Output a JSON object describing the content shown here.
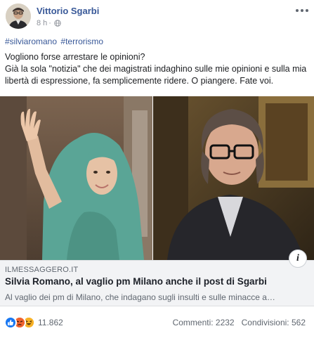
{
  "post": {
    "author": "Vittorio Sgarbi",
    "time": "8 h",
    "hashtags": [
      "#silviaromano",
      "#terrorismo"
    ],
    "text_line1": "Vogliono forse arrestare le opinioni?",
    "text_line2": "Già la sola \"notizia\" che dei magistrati indaghino sulle mie opinioni e sulla mia libertà di espressione, fa semplicemente ridere. O piangere. Fate voi."
  },
  "link": {
    "domain": "ILMESSAGGERO.IT",
    "title": "Silvia Romano, al vaglio pm Milano anche il post di Sgarbi",
    "description": "Al vaglio dei pm di Milano, che indagano sugli insulti e sulle minacce a…",
    "info_glyph": "i"
  },
  "footer": {
    "reaction_count": "11.862",
    "comments": "Commenti: 2232",
    "shares": "Condivisioni: 562"
  },
  "icons": {
    "reactions": [
      "like-icon",
      "angry-icon",
      "haha-icon"
    ],
    "privacy": "globe-icon",
    "more": "more-options-icon"
  },
  "colors": {
    "link_blue": "#385898",
    "like_blue": "#1877f2",
    "angry_orange": "#e9710f",
    "haha_yellow": "#f7b125",
    "muted": "#606770"
  }
}
